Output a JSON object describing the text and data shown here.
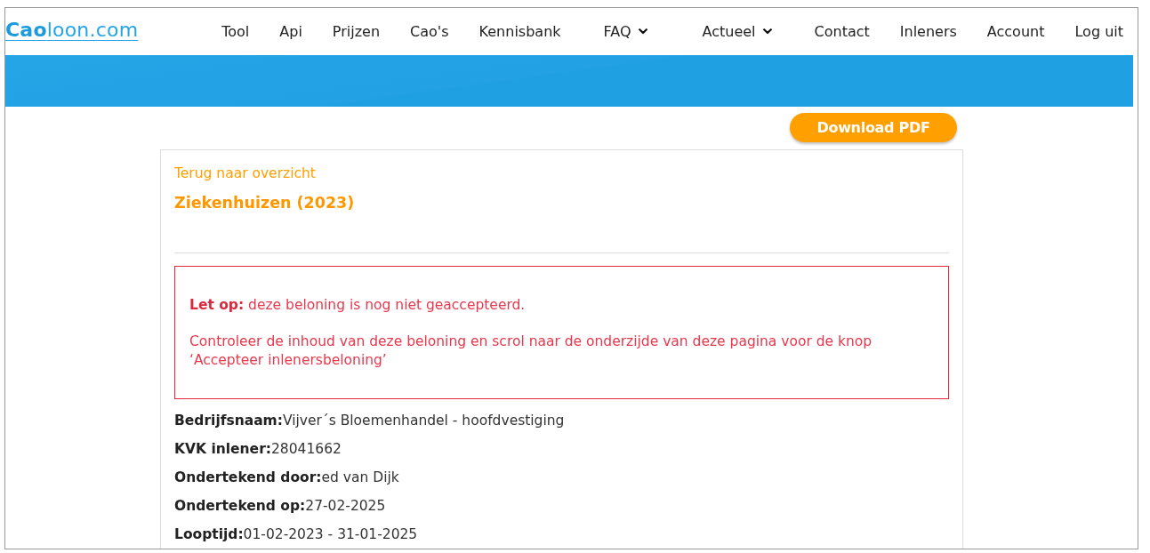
{
  "logo": {
    "text": "**Cao**loon.com"
  },
  "nav": [
    {
      "label": "Tool",
      "dropdown": false
    },
    {
      "label": "Api",
      "dropdown": false
    },
    {
      "label": "Prijzen",
      "dropdown": false
    },
    {
      "label": "Cao's",
      "dropdown": false
    },
    {
      "label": "Kennisbank",
      "dropdown": false
    },
    {
      "label": "FAQ",
      "dropdown": true
    },
    {
      "label": "Actueel",
      "dropdown": true
    },
    {
      "label": "Contact",
      "dropdown": false
    },
    {
      "label": "Inleners",
      "dropdown": false
    },
    {
      "label": "Account",
      "dropdown": false
    },
    {
      "label": "Log uit",
      "dropdown": false
    }
  ],
  "download_button": "Download PDF",
  "card": {
    "back_link": "Terug naar overzicht",
    "title": "Ziekenhuizen (2023)",
    "alert": {
      "lines": [
        "**Let op:** deze beloning is nog niet geaccepteerd.",
        "Controleer de inhoud van deze beloning en scrol naar de onderzijde van deze pagina voor de knop ‘Accepteer inlenersbeloning’"
      ]
    },
    "fields": [
      {
        "label": "Bedrijfsnaam:",
        "value": "Vijver´s Bloemenhandel - hoofdvestiging"
      },
      {
        "label": "KVK inlener:",
        "value": "28041662"
      },
      {
        "label": "Ondertekend door:",
        "value": "ed van Dijk"
      },
      {
        "label": "Ondertekend op:",
        "value": "27-02-2025"
      },
      {
        "label": "Looptijd:",
        "value": "01-02-2023 - 31-01-2025"
      }
    ]
  }
}
